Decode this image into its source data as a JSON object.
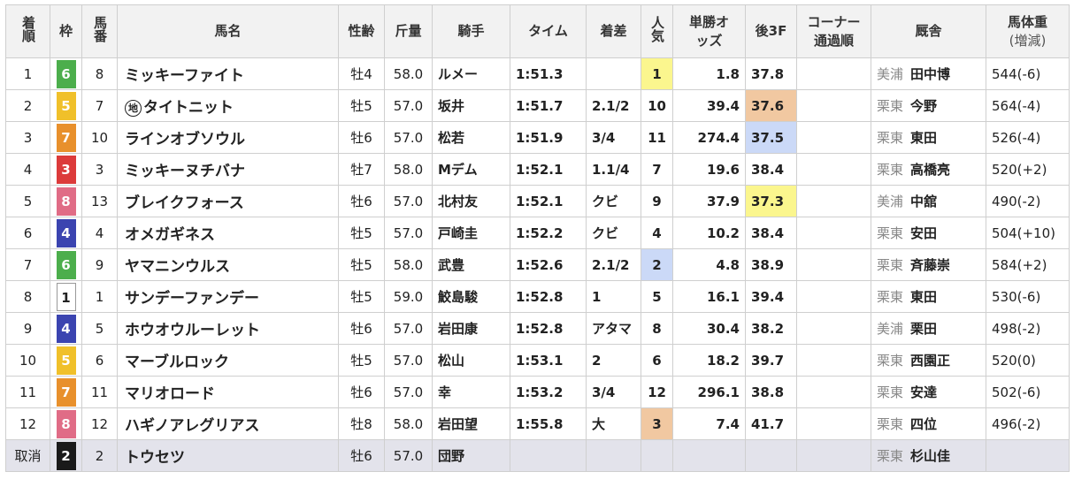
{
  "headers": {
    "finish": "着順",
    "frame": "枠",
    "number": "馬番",
    "horse": "馬名",
    "sex_age": "性齢",
    "weight": "斤量",
    "jockey": "騎手",
    "time": "タイム",
    "margin": "着差",
    "popularity": "人気",
    "odds": "単勝オッズ",
    "last3f": "後3F",
    "corner": "コーナー通過順",
    "stable": "厩舎",
    "body_weight": "馬体重",
    "body_weight_sub": "(増減)"
  },
  "frame_colors": {
    "1": {
      "bg": "#ffffff",
      "fg": "#222222"
    },
    "2": {
      "bg": "#1a1a1a",
      "fg": "#ffffff"
    },
    "3": {
      "bg": "#dc3b3b",
      "fg": "#ffffff"
    },
    "4": {
      "bg": "#3b44b0",
      "fg": "#ffffff"
    },
    "5": {
      "bg": "#f0c02a",
      "fg": "#ffffff"
    },
    "6": {
      "bg": "#4cae4c",
      "fg": "#ffffff"
    },
    "7": {
      "bg": "#e8902c",
      "fg": "#ffffff"
    },
    "8": {
      "bg": "#e06c86",
      "fg": "#ffffff"
    }
  },
  "highlight_colors": {
    "yellow": "#fbf68e",
    "orange": "#f1c8a1",
    "blue": "#cbd9f7"
  },
  "chihou_mark": "地",
  "rows": [
    {
      "finish": "1",
      "frame": "6",
      "number": "8",
      "horse": "ミッキーファイト",
      "chihou": false,
      "sex_age": "牡4",
      "weight": "58.0",
      "jockey": "ルメー",
      "time": "1:51.3",
      "margin": "",
      "popularity": "1",
      "pop_hl": "yellow",
      "odds": "1.8",
      "odds_red": true,
      "last3f": "37.8",
      "l3f_hl": "",
      "corner": "",
      "region": "美浦",
      "stable": "田中博",
      "body_weight": "544(-6)"
    },
    {
      "finish": "2",
      "frame": "5",
      "number": "7",
      "horse": "タイトニット",
      "chihou": true,
      "sex_age": "牡5",
      "weight": "57.0",
      "jockey": "坂井",
      "time": "1:51.7",
      "margin": "2.1/2",
      "popularity": "10",
      "pop_hl": "",
      "odds": "39.4",
      "odds_red": false,
      "last3f": "37.6",
      "l3f_hl": "orange",
      "corner": "",
      "region": "栗東",
      "stable": "今野",
      "body_weight": "564(-4)"
    },
    {
      "finish": "3",
      "frame": "7",
      "number": "10",
      "horse": "ラインオブソウル",
      "chihou": false,
      "sex_age": "牡6",
      "weight": "57.0",
      "jockey": "松若",
      "time": "1:51.9",
      "margin": "3/4",
      "popularity": "11",
      "pop_hl": "",
      "odds": "274.4",
      "odds_red": false,
      "last3f": "37.5",
      "l3f_hl": "blue",
      "corner": "",
      "region": "栗東",
      "stable": "東田",
      "body_weight": "526(-4)"
    },
    {
      "finish": "4",
      "frame": "3",
      "number": "3",
      "horse": "ミッキーヌチバナ",
      "chihou": false,
      "sex_age": "牡7",
      "weight": "58.0",
      "jockey": "Mデム",
      "time": "1:52.1",
      "margin": "1.1/4",
      "popularity": "7",
      "pop_hl": "",
      "odds": "19.6",
      "odds_red": false,
      "last3f": "38.4",
      "l3f_hl": "",
      "corner": "",
      "region": "栗東",
      "stable": "高橋亮",
      "body_weight": "520(+2)"
    },
    {
      "finish": "5",
      "frame": "8",
      "number": "13",
      "horse": "ブレイクフォース",
      "chihou": false,
      "sex_age": "牡6",
      "weight": "57.0",
      "jockey": "北村友",
      "time": "1:52.1",
      "margin": "クビ",
      "popularity": "9",
      "pop_hl": "",
      "odds": "37.9",
      "odds_red": false,
      "last3f": "37.3",
      "l3f_hl": "yellow",
      "corner": "",
      "region": "美浦",
      "stable": "中舘",
      "body_weight": "490(-2)"
    },
    {
      "finish": "6",
      "frame": "4",
      "number": "4",
      "horse": "オメガギネス",
      "chihou": false,
      "sex_age": "牡5",
      "weight": "57.0",
      "jockey": "戸崎圭",
      "time": "1:52.2",
      "margin": "クビ",
      "popularity": "4",
      "pop_hl": "",
      "odds": "10.2",
      "odds_red": false,
      "last3f": "38.4",
      "l3f_hl": "",
      "corner": "",
      "region": "栗東",
      "stable": "安田",
      "body_weight": "504(+10)"
    },
    {
      "finish": "7",
      "frame": "6",
      "number": "9",
      "horse": "ヤマニンウルス",
      "chihou": false,
      "sex_age": "牡5",
      "weight": "58.0",
      "jockey": "武豊",
      "time": "1:52.6",
      "margin": "2.1/2",
      "popularity": "2",
      "pop_hl": "blue",
      "odds": "4.8",
      "odds_red": true,
      "last3f": "38.9",
      "l3f_hl": "",
      "corner": "",
      "region": "栗東",
      "stable": "斉藤崇",
      "body_weight": "584(+2)"
    },
    {
      "finish": "8",
      "frame": "1",
      "number": "1",
      "horse": "サンデーファンデー",
      "chihou": false,
      "sex_age": "牡5",
      "weight": "59.0",
      "jockey": "鮫島駿",
      "time": "1:52.8",
      "margin": "1",
      "popularity": "5",
      "pop_hl": "",
      "odds": "16.1",
      "odds_red": false,
      "last3f": "39.4",
      "l3f_hl": "",
      "corner": "",
      "region": "栗東",
      "stable": "東田",
      "body_weight": "530(-6)"
    },
    {
      "finish": "9",
      "frame": "4",
      "number": "5",
      "horse": "ホウオウルーレット",
      "chihou": false,
      "sex_age": "牡6",
      "weight": "57.0",
      "jockey": "岩田康",
      "time": "1:52.8",
      "margin": "アタマ",
      "popularity": "8",
      "pop_hl": "",
      "odds": "30.4",
      "odds_red": false,
      "last3f": "38.2",
      "l3f_hl": "",
      "corner": "",
      "region": "美浦",
      "stable": "栗田",
      "body_weight": "498(-2)"
    },
    {
      "finish": "10",
      "frame": "5",
      "number": "6",
      "horse": "マーブルロック",
      "chihou": false,
      "sex_age": "牡5",
      "weight": "57.0",
      "jockey": "松山",
      "time": "1:53.1",
      "margin": "2",
      "popularity": "6",
      "pop_hl": "",
      "odds": "18.2",
      "odds_red": false,
      "last3f": "39.7",
      "l3f_hl": "",
      "corner": "",
      "region": "栗東",
      "stable": "西園正",
      "body_weight": "520(0)"
    },
    {
      "finish": "11",
      "frame": "7",
      "number": "11",
      "horse": "マリオロード",
      "chihou": false,
      "sex_age": "牡6",
      "weight": "57.0",
      "jockey": "幸",
      "time": "1:53.2",
      "margin": "3/4",
      "popularity": "12",
      "pop_hl": "",
      "odds": "296.1",
      "odds_red": false,
      "last3f": "38.8",
      "l3f_hl": "",
      "corner": "",
      "region": "栗東",
      "stable": "安達",
      "body_weight": "502(-6)"
    },
    {
      "finish": "12",
      "frame": "8",
      "number": "12",
      "horse": "ハギノアレグリアス",
      "chihou": false,
      "sex_age": "牡8",
      "weight": "58.0",
      "jockey": "岩田望",
      "time": "1:55.8",
      "margin": "大",
      "popularity": "3",
      "pop_hl": "orange",
      "odds": "7.4",
      "odds_red": true,
      "last3f": "41.7",
      "l3f_hl": "",
      "corner": "",
      "region": "栗東",
      "stable": "四位",
      "body_weight": "496(-2)"
    },
    {
      "finish": "取消",
      "frame": "2",
      "number": "2",
      "horse": "トウセツ",
      "chihou": false,
      "sex_age": "牡6",
      "weight": "57.0",
      "jockey": "団野",
      "time": "",
      "margin": "",
      "popularity": "",
      "pop_hl": "",
      "odds": "",
      "odds_red": false,
      "last3f": "",
      "l3f_hl": "",
      "corner": "",
      "region": "栗東",
      "stable": "杉山佳",
      "body_weight": ""
    }
  ]
}
